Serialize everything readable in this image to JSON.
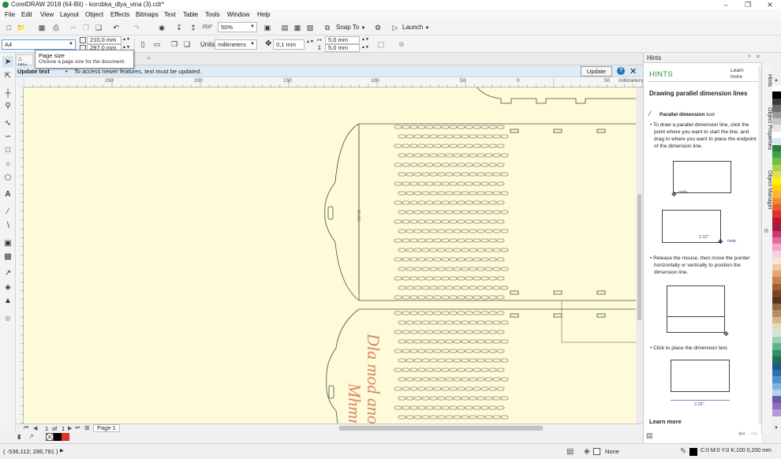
{
  "window": {
    "title": "CorelDRAW 2018 (64-Bit) - korobka_dlya_vina (3).cdr*",
    "minimize": "–",
    "maximize": "❐",
    "close": "✕"
  },
  "menu": [
    "File",
    "Edit",
    "View",
    "Layout",
    "Object",
    "Effects",
    "Bitmaps",
    "Text",
    "Table",
    "Tools",
    "Window",
    "Help"
  ],
  "toolbar": {
    "zoom": "50%",
    "snap_to": "Snap To",
    "launch": "Launch"
  },
  "property_bar": {
    "page_size": "A4",
    "width": "210,0 mm",
    "height": "297,0 mm",
    "units_label": "Units:",
    "units": "millimeters",
    "nudge": "0,1 mm",
    "dup_x": "5,0 mm",
    "dup_y": "5,0 mm"
  },
  "tooltip": {
    "title": "Page size",
    "body": "Choose a page size for the document."
  },
  "tabs": {
    "welcome": "We",
    "add": "+"
  },
  "notice": {
    "title": "Update text",
    "message": "To access newer features, text must be updated.",
    "button": "Update",
    "help": "?",
    "close": "✕"
  },
  "ruler": {
    "ticks": [
      "250",
      "200",
      "150",
      "100",
      "50",
      "0",
      "50"
    ],
    "unit": "millimeters"
  },
  "canvas": {
    "dimension_label": "200.00",
    "script_text_1": "Dla mod ano",
    "script_text_2": "Mhmm"
  },
  "page_nav": {
    "current": "1",
    "of": "of",
    "total": "1",
    "page_tab": "Page 1"
  },
  "status": {
    "coords": "( -536,112; 286,781 )",
    "fill": "None",
    "outline": "C:0 M:0 Y:0 K:100  0,200 mm"
  },
  "hints": {
    "panel_title": "Hints",
    "heading": "HINTS",
    "learn_more_top": "Learn more",
    "title": "Drawing parallel dimension lines",
    "tool_name": "Parallel dimension",
    "tool_suffix": " tool",
    "step1": "To draw a parallel dimension line, click the point where you want to start the line, and drag to where you want to place the endpoint of the dimension line.",
    "node_label": "node",
    "dim_value": "2.22\"",
    "step2": "Release the mouse, then move the pointer horizontally or vertically to position the dimension line.",
    "step3": "Click to place the dimension text.",
    "learn_more": "Learn more"
  },
  "docker_tabs": [
    "Hints",
    "Object Properties",
    "Object Manager"
  ],
  "colors": {
    "canvas": "#fefbd8",
    "accent": "#2f8f3a",
    "notice_bg": "#deebf5",
    "script_text": "#d9876a"
  },
  "palette": [
    "#ffffff",
    "#000000",
    "#3a3a3a",
    "#6e6e6e",
    "#9a9a9a",
    "#c8c8c8",
    "#e6e6e6",
    "#ffffff",
    "#d6e9f7",
    "#2a7f3f",
    "#3aa34a",
    "#6fbf3a",
    "#a6d24c",
    "#dde34e",
    "#fff200",
    "#ffd200",
    "#f7b733",
    "#f08b2a",
    "#e95b2a",
    "#e0312b",
    "#c4132d",
    "#9e1e3b",
    "#d2386c",
    "#e56aa0",
    "#f3a6c4",
    "#f8cfe0",
    "#fbe3d6",
    "#f5c6a5",
    "#e6a474",
    "#c98050",
    "#a35f33",
    "#7a4424",
    "#5a3318",
    "#8f6a43",
    "#b58f5d",
    "#d4b98c",
    "#e9d9b8",
    "#cfe7d4",
    "#9ed0b0",
    "#5fb38a",
    "#2f8f6c",
    "#1f6f5a",
    "#1d5a86",
    "#2c6fb5",
    "#4e91d2",
    "#7fb2e4",
    "#b3d2f0",
    "#6b5ba8",
    "#8e6fbf",
    "#b49ad6"
  ],
  "color_wells": [
    "#ffffff",
    "#000000",
    "#e0312b"
  ]
}
